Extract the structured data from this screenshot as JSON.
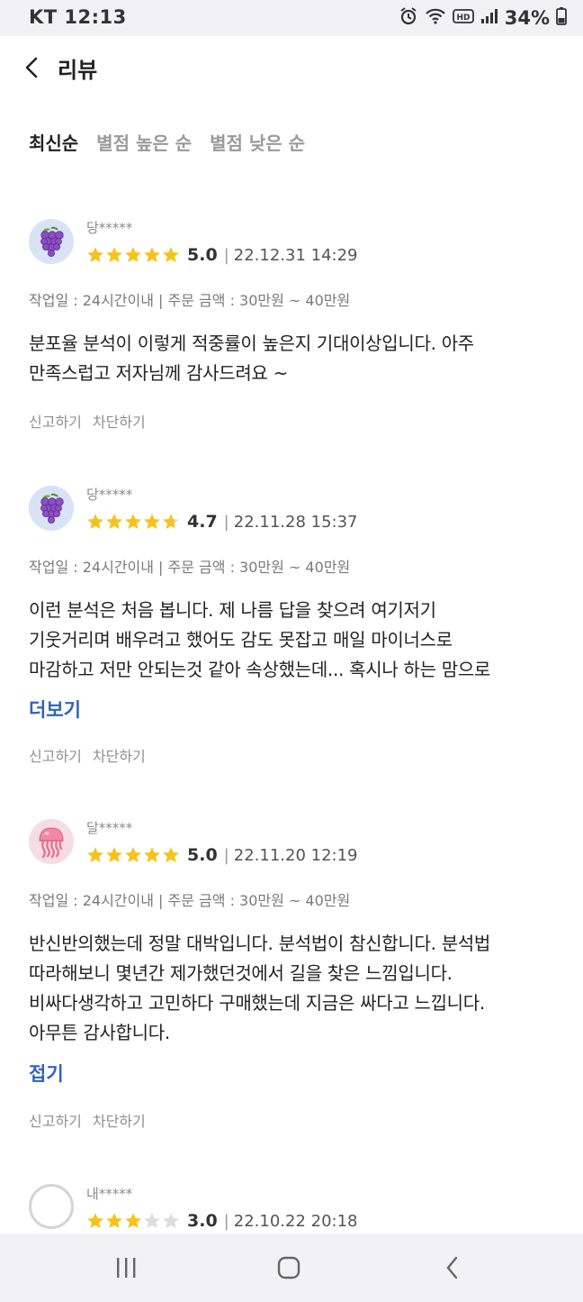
{
  "status_bar": {
    "carrier_time": "KT 12:13",
    "battery": "34%"
  },
  "header": {
    "title": "리뷰"
  },
  "sort_tabs": [
    {
      "label": "최신순",
      "active": true
    },
    {
      "label": "별점 높은 순",
      "active": false
    },
    {
      "label": "별점 낮은 순",
      "active": false
    }
  ],
  "reviews": [
    {
      "nickname": "당*****",
      "avatar": "grape-icon",
      "score": "5.0",
      "stars": 5,
      "date": "22.12.31 14:29",
      "meta": "작업일 : 24시간이내 | 주문 금액 : 30만원 ~ 40만원",
      "lines": [
        "분포율 분석이 이렇게 적중률이 높은지 기대이상입니다. 아주",
        "만족스럽고 저자님께 감사드려요 ~"
      ],
      "toggle": "",
      "report": "신고하기",
      "block": "차단하기"
    },
    {
      "nickname": "당*****",
      "avatar": "grape-icon",
      "score": "4.7",
      "stars": 4.7,
      "date": "22.11.28 15:37",
      "meta": "작업일 : 24시간이내 | 주문 금액 : 30만원 ~ 40만원",
      "lines": [
        "이런 분석은 처음 봅니다. 제 나름 답을 찾으려 여기저기",
        "기웃거리며 배우려고 했어도 감도 못잡고 매일 마이너스로",
        "마감하고 저만 안되는것 같아 속상했는데... 혹시나 하는 맘으로"
      ],
      "toggle": "더보기",
      "report": "신고하기",
      "block": "차단하기"
    },
    {
      "nickname": "달*****",
      "avatar": "jellyfish-icon",
      "score": "5.0",
      "stars": 5,
      "date": "22.11.20 12:19",
      "meta": "작업일 : 24시간이내 | 주문 금액 : 30만원 ~ 40만원",
      "lines": [
        "반신반의했는데 정말 대박입니다. 분석법이 참신합니다. 분석법",
        "따라해보니 몇년간 제가했던것에서 길을 찾은 느낌입니다.",
        "비싸다생각하고 고민하다 구매했는데 지금은 싸다고 느낍니다.",
        "아무튼 감사합니다."
      ],
      "toggle": "접기",
      "report": "신고하기",
      "block": "차단하기"
    },
    {
      "nickname": "내*****",
      "avatar": "default-avatar-icon",
      "score": "3.0",
      "stars": 3,
      "date": "22.10.22 20:18"
    }
  ],
  "colors": {
    "star": "#f7c21b",
    "star_empty": "#dcdcdc",
    "link": "#2f63bf"
  }
}
